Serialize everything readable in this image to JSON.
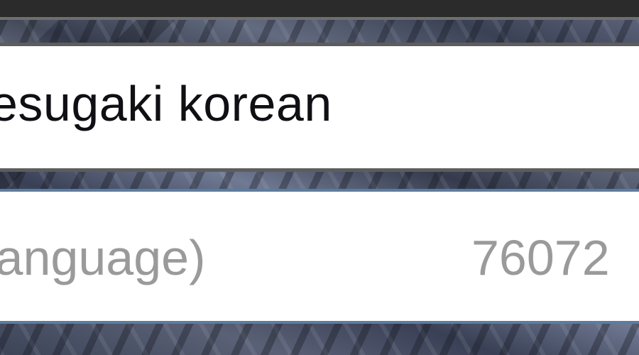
{
  "search": {
    "query": "esugaki korean"
  },
  "suggestions": [
    {
      "label": "language)",
      "count": "76072"
    }
  ]
}
